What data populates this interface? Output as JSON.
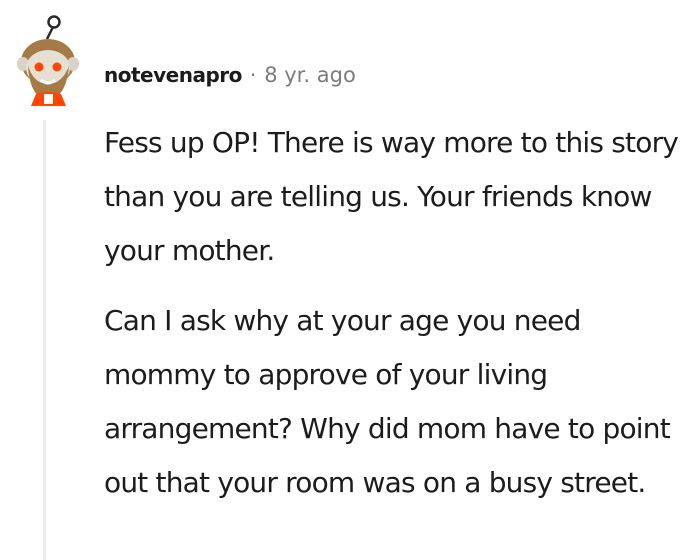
{
  "comment": {
    "author": "notevenapro",
    "separator": "·",
    "time": "8 yr. ago",
    "avatar_icon": "snoo-avatar-icon",
    "paragraphs": [
      "Fess up OP! There is way more to this story than you are telling us. Your friends know your mother.",
      "Can I ask why at your age you need mommy to approve of your living arrangement? Why did mom have to point out that your room was on a busy street."
    ]
  }
}
